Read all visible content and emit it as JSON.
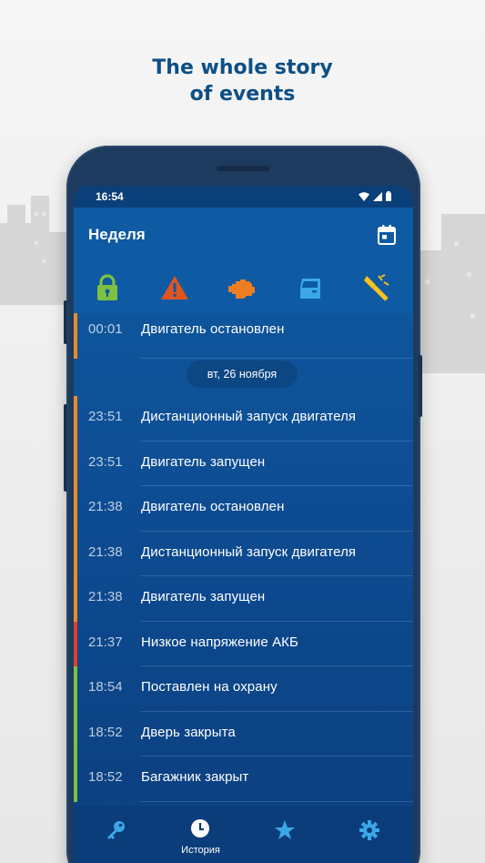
{
  "promo": {
    "headline_line1": "The whole story",
    "headline_line2": "of events"
  },
  "status_bar": {
    "time": "16:54",
    "icons": [
      "wifi-icon",
      "signal-icon",
      "battery-icon"
    ]
  },
  "app_bar": {
    "title": "Неделя",
    "calendar_icon": "calendar-icon"
  },
  "filters": [
    {
      "name": "lock-filter",
      "icon": "lock-icon",
      "color": "#7cc142"
    },
    {
      "name": "warning-filter",
      "icon": "warning-icon",
      "color": "#e2541e"
    },
    {
      "name": "engine-filter",
      "icon": "engine-icon",
      "color": "#ef7d22"
    },
    {
      "name": "door-filter",
      "icon": "car-door-icon",
      "color": "#3aa8e8"
    },
    {
      "name": "shock-filter",
      "icon": "shock-sensor-icon",
      "color": "#f4c21b"
    }
  ],
  "events_top": [
    {
      "time": "00:01",
      "text": "Двигатель остановлен",
      "color": "#e98b2a"
    }
  ],
  "date_separator": "вт, 26 ноября",
  "events": [
    {
      "time": "23:51",
      "text": "Дистанционный запуск двигателя",
      "color": "#e98b2a"
    },
    {
      "time": "23:51",
      "text": "Двигатель запущен",
      "color": "#e98b2a"
    },
    {
      "time": "21:38",
      "text": "Двигатель остановлен",
      "color": "#e98b2a"
    },
    {
      "time": "21:38",
      "text": "Дистанционный запуск двигателя",
      "color": "#e98b2a"
    },
    {
      "time": "21:38",
      "text": "Двигатель запущен",
      "color": "#e98b2a"
    },
    {
      "time": "21:37",
      "text": "Низкое напряжение АКБ",
      "color": "#d9412b"
    },
    {
      "time": "18:54",
      "text": "Поставлен на охрану",
      "color": "#7cc142"
    },
    {
      "time": "18:52",
      "text": "Дверь закрыта",
      "color": "#7cc142"
    },
    {
      "time": "18:52",
      "text": "Багажник закрыт",
      "color": "#7cc142"
    }
  ],
  "bottom_nav": [
    {
      "icon": "key-icon",
      "label": ""
    },
    {
      "icon": "clock-icon",
      "label": "История"
    },
    {
      "icon": "star-icon",
      "label": ""
    },
    {
      "icon": "gear-icon",
      "label": ""
    }
  ]
}
